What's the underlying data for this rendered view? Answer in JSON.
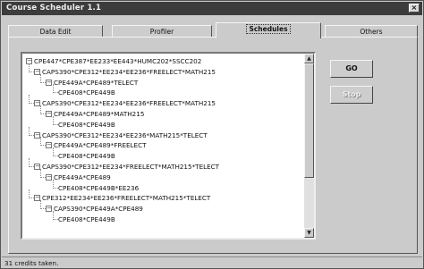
{
  "window": {
    "title": "Course Scheduler 1.1",
    "close_glyph": "×"
  },
  "tabs": [
    {
      "label": "Data Edit"
    },
    {
      "label": "Profiler"
    },
    {
      "label": "Schedules",
      "active": true
    },
    {
      "label": "Others"
    }
  ],
  "tree": [
    {
      "level": 0,
      "expander": "−",
      "text": "CPE447*CPE387*EE233*EE443*HUMC202*SSCC202"
    },
    {
      "level": 1,
      "expander": "−",
      "text": "CAPS390*CPE312*EE234*EE236*FREELECT*MATH215"
    },
    {
      "level": 2,
      "expander": "−",
      "text": "CPE449A*CPE489*TELECT"
    },
    {
      "level": 3,
      "expander": "",
      "text": "CPE408*CPE449B"
    },
    {
      "level": 1,
      "expander": "−",
      "text": "CAPS390*CPE312*EE234*EE236*FREELECT*MATH215"
    },
    {
      "level": 2,
      "expander": "−",
      "text": "CPE449A*CPE489*MATH215"
    },
    {
      "level": 3,
      "expander": "",
      "text": "CPE408*CPE449B"
    },
    {
      "level": 1,
      "expander": "−",
      "text": "CAPS390*CPE312*EE234*EE236*MATH215*TELECT"
    },
    {
      "level": 2,
      "expander": "−",
      "text": "CPE449A*CPE489*FREELECT"
    },
    {
      "level": 3,
      "expander": "",
      "text": "CPE408*CPE449B"
    },
    {
      "level": 1,
      "expander": "−",
      "text": "CAPS390*CPE312*EE234*FREELECT*MATH215*TELECT"
    },
    {
      "level": 2,
      "expander": "−",
      "text": "CPE449A*CPE489"
    },
    {
      "level": 3,
      "expander": "",
      "text": "CPE408*CPE449B*EE236"
    },
    {
      "level": 1,
      "expander": "−",
      "text": "CPE312*EE234*EE236*FREELECT*MATH215*TELECT"
    },
    {
      "level": 2,
      "expander": "−",
      "text": "CAPS390*CPE449A*CPE489"
    },
    {
      "level": 3,
      "expander": "",
      "text": "CPE408*CPE449B"
    }
  ],
  "buttons": {
    "go": "GO",
    "stop": "Stop"
  },
  "status": {
    "text": "31 credits taken."
  },
  "scroll": {
    "up_glyph": "▲",
    "down_glyph": "▼"
  }
}
